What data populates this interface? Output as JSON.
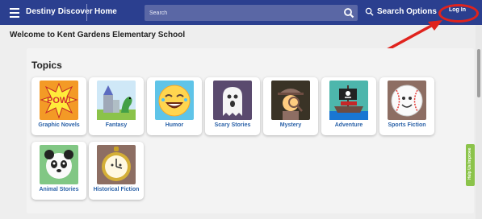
{
  "header": {
    "brand": "Destiny Discover",
    "home": "Home",
    "search_placeholder": "Search",
    "search_options": "Search Options",
    "login": "Log In"
  },
  "welcome": "Welcome to Kent Gardens Elementary School",
  "topics": {
    "title": "Topics",
    "items": [
      {
        "label": "Graphic Novels",
        "icon": "pow-comic-icon"
      },
      {
        "label": "Fantasy",
        "icon": "castle-dragon-icon"
      },
      {
        "label": "Humor",
        "icon": "laughing-face-icon"
      },
      {
        "label": "Scary Stories",
        "icon": "ghost-icon"
      },
      {
        "label": "Mystery",
        "icon": "detective-icon"
      },
      {
        "label": "Adventure",
        "icon": "pirate-ship-icon"
      },
      {
        "label": "Sports Fiction",
        "icon": "baseball-icon"
      },
      {
        "label": "Animal Stories",
        "icon": "panda-icon"
      },
      {
        "label": "Historical Fiction",
        "icon": "pocket-watch-icon"
      }
    ]
  },
  "help_tab": "Help Us Improve",
  "colors": {
    "header": "#2b3f8f",
    "link": "#2b62a8",
    "annotation": "#e0231d",
    "help_tab": "#8bc34a"
  }
}
